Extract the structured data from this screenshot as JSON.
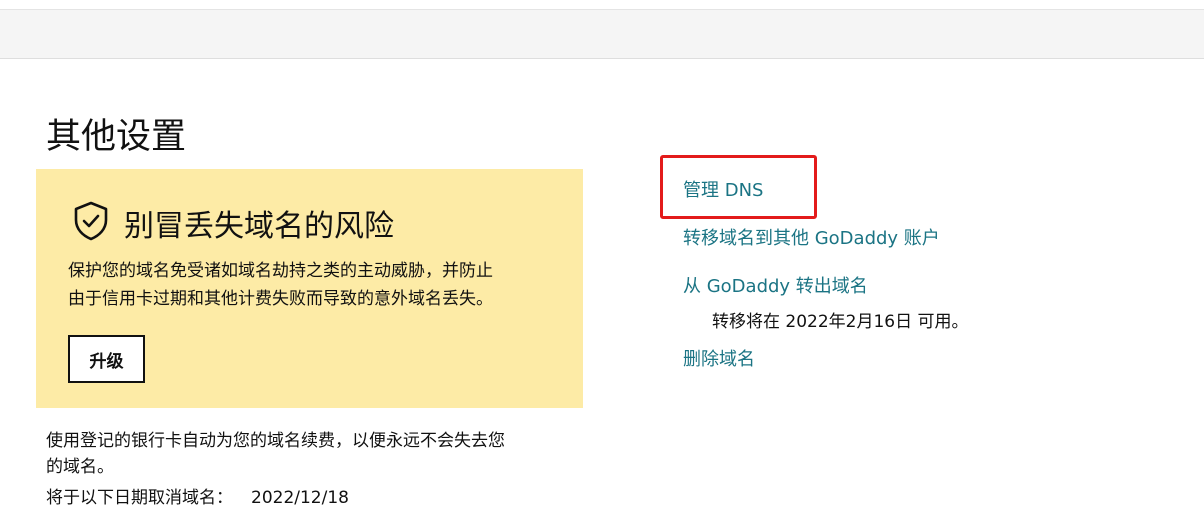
{
  "section": {
    "title": "其他设置"
  },
  "promo": {
    "icon": "shield-check-icon",
    "title": "别冒丢失域名的风险",
    "line1": "保护您的域名免受诸如域名劫持之类的主动威胁，并防止",
    "line2": "由于信用卡过期和其他计费失败而导致的意外域名丢失。",
    "upgrade_label": "升级"
  },
  "autorenew": {
    "line1": "使用登记的银行卡自动为您的域名续费，以便永远不会失去您",
    "line2": "的域名。",
    "cancel_label": "将于以下日期取消域名：",
    "cancel_date": "2022/12/18"
  },
  "links": {
    "manage_dns": "管理 DNS",
    "transfer_to_account": "转移域名到其他 GoDaddy 账户",
    "transfer_out": "从 GoDaddy 转出域名",
    "transfer_note": "转移将在 2022年2月16日 可用。",
    "delete_domain": "删除域名"
  },
  "colors": {
    "promo_background": "#fdeba6",
    "link": "#1b7484",
    "highlight": "#e31b1b"
  }
}
